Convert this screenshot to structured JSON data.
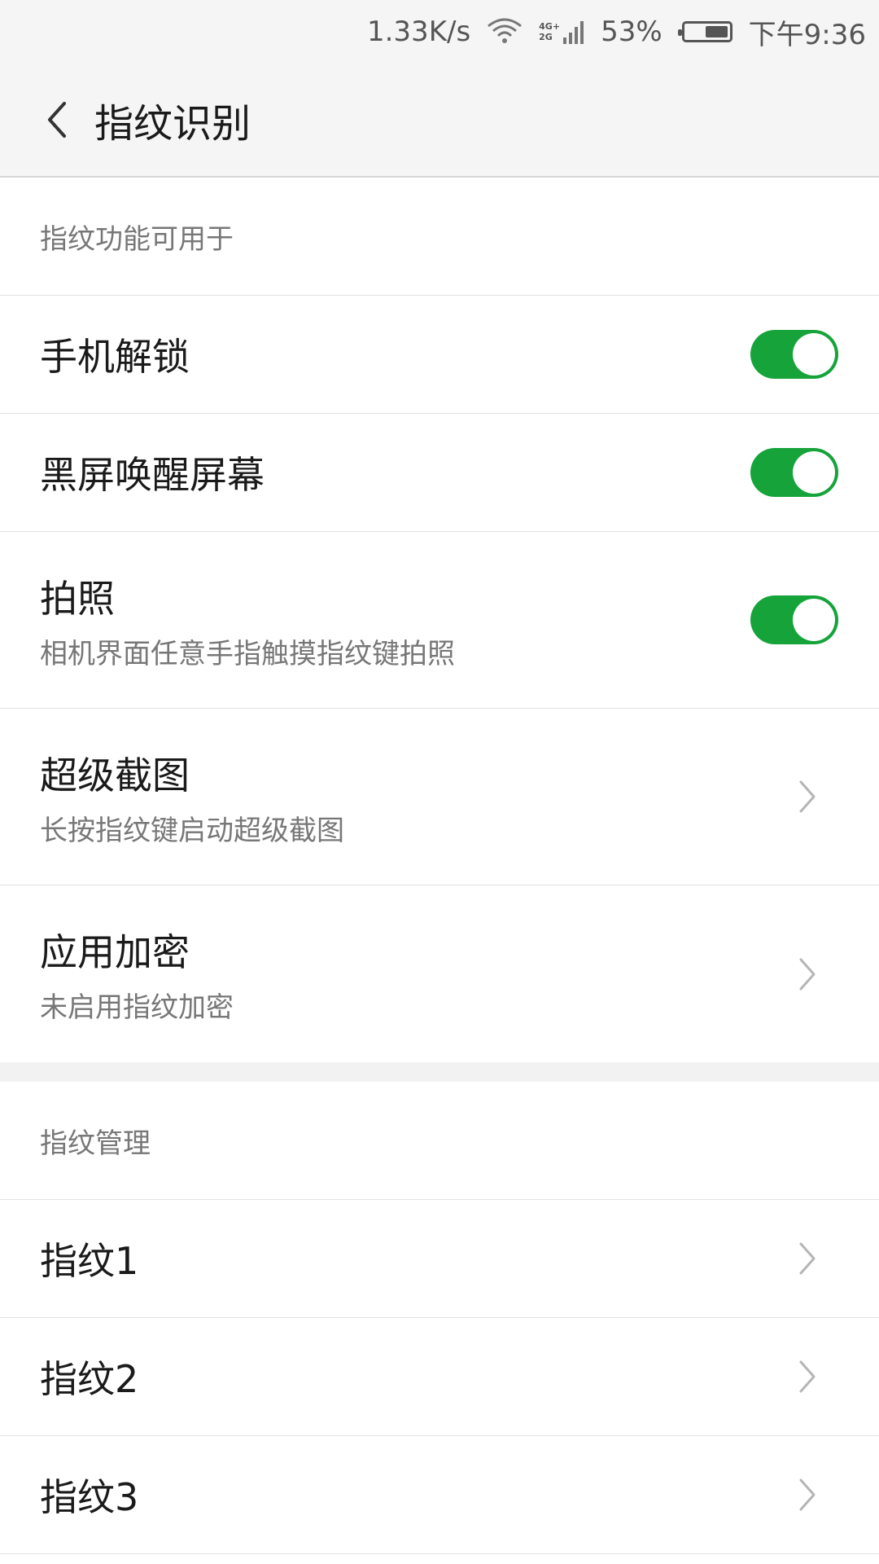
{
  "status_bar": {
    "net_speed": "1.33K/s",
    "net_type_top": "4G+",
    "net_type_bottom": "2G",
    "battery": "53%",
    "battery_level": 0.53,
    "time": "下午9:36"
  },
  "header": {
    "title": "指纹识别"
  },
  "section1": {
    "title": "指纹功能可用于",
    "items": [
      {
        "title": "手机解锁",
        "toggle_on": true
      },
      {
        "title": "黑屏唤醒屏幕",
        "toggle_on": true
      },
      {
        "title": "拍照",
        "subtitle": "相机界面任意手指触摸指纹键拍照",
        "toggle_on": true
      },
      {
        "title": "超级截图",
        "subtitle": "长按指纹键启动超级截图"
      },
      {
        "title": "应用加密",
        "subtitle": "未启用指纹加密"
      }
    ]
  },
  "section2": {
    "title": "指纹管理",
    "items": [
      {
        "title": "指纹1"
      },
      {
        "title": "指纹2"
      },
      {
        "title": "指纹3"
      }
    ]
  },
  "colors": {
    "toggle_on": "#15a33a",
    "header_bg": "#f5f5f5"
  }
}
